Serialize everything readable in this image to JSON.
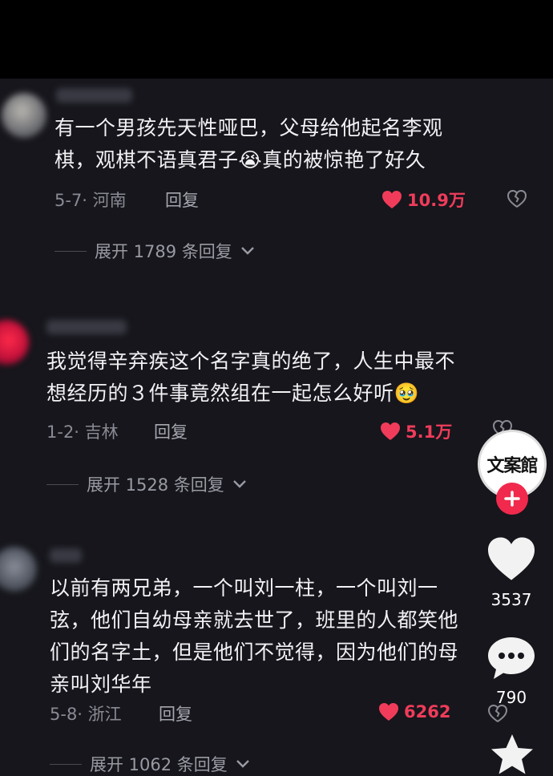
{
  "comments": [
    {
      "text": "有一个男孩先天性哑巴，父母给他起名李观棋，观棋不语真君子😭真的被惊艳了好久",
      "line1": "有一个男孩先天性哑巴，父母给他起名李观",
      "line2": "棋，观棋不语真君子😭真的被惊艳了好久",
      "date_location": "5-7· 河南",
      "reply_label": "回复",
      "likes": "10.9万",
      "expand_label": "展开 1789 条回复"
    },
    {
      "text": "我觉得辛弃疾这个名字真的绝了，人生中最不想经历的3件事竟然组在一起怎么好听🥹",
      "line1": "我觉得辛弃疾这个名字真的绝了，人生中最不",
      "line2": "想经历的３件事竟然组在一起怎么好听🥹",
      "date_location": "1-2· 吉林",
      "reply_label": "回复",
      "likes": "5.1万",
      "expand_label": "展开 1528 条回复"
    },
    {
      "text": "以前有两兄弟，一个叫刘一柱，一个叫刘一弦，他们自幼母亲就去世了，班里的人都笑他们的名字土，但是他们不觉得，因为他们的母亲叫刘华年",
      "line1": "以前有两兄弟，一个叫刘一柱，一个叫刘一",
      "line2": "弦，他们自幼母亲就去世了，班里的人都笑他",
      "line3": "们的名字土，但是他们不觉得，因为他们的母",
      "line4": "亲叫刘华年",
      "date_location": "5-8· 浙江",
      "reply_label": "回复",
      "likes": "6262",
      "expand_label": "展开 1062 条回复"
    }
  ],
  "sidebar": {
    "account_logo_text": "文案館",
    "like_count": "3537",
    "comment_count": "790"
  },
  "colors": {
    "background": "#16161c",
    "like_red": "#f03c5a",
    "follow_red": "#f0294d"
  }
}
